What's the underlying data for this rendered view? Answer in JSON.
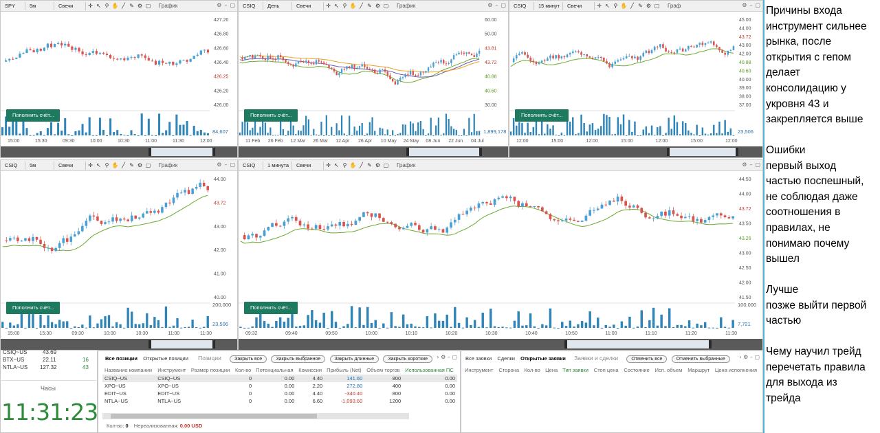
{
  "toolbar_icons": [
    "crosshair-icon",
    "cursor-icon",
    "zoom-icon",
    "hand-icon",
    "draw-line-icon",
    "pencil-icon",
    "settings-icon",
    "square-icon"
  ],
  "charts": {
    "spy": {
      "symbol": "SPY",
      "interval": "5м",
      "type": "Свечи",
      "title": "График",
      "price_axis": [
        "427.20",
        "426.80",
        "426.60",
        "426.40",
        "426.25",
        "426.20",
        "426.00"
      ],
      "time_axis": [
        "15:00",
        "15:30",
        "09:30",
        "10:00",
        "10:30",
        "11:00",
        "11:30",
        "12:00"
      ],
      "deposit_label": "Пополнить счёт...",
      "volume_value": "84,607"
    },
    "csiq_day": {
      "symbol": "CSIQ",
      "interval": "День",
      "type": "Свечи",
      "title": "График",
      "price_axis": [
        "60.00",
        "50.00",
        "43.81",
        "43.72",
        "40.88",
        "40.60",
        "30.00"
      ],
      "time_axis": [
        "11 Feb",
        "26 Feb",
        "12 Mar",
        "26 Mar",
        "12 Apr",
        "26 Apr",
        "10 May",
        "24 May",
        "08 Jun",
        "22 Jun",
        "04 Jul"
      ],
      "deposit_label": "Пополнить счёт...",
      "volume_value": "1,899,178"
    },
    "csiq_15m": {
      "symbol": "CSIQ",
      "interval": "15 минут",
      "type": "Свечи",
      "title": "Граф",
      "price_axis": [
        "45.00",
        "44.00",
        "43.72",
        "43.00",
        "42.00",
        "40.88",
        "40.60",
        "40.00",
        "39.00",
        "38.00",
        "37.00"
      ],
      "time_axis": [
        "12:00",
        "15:00",
        "12:00",
        "15:00",
        "12:00",
        "15:00",
        "12:00"
      ],
      "deposit_label": "Пополнить счёт...",
      "volume_value": "23,506"
    },
    "csiq_5m": {
      "symbol": "CSIQ",
      "interval": "5м",
      "type": "Свечи",
      "title": "График",
      "price_axis": [
        "44.00",
        "43.72",
        "43.00",
        "42.00",
        "41.00",
        "40.00"
      ],
      "time_axis": [
        "15:00",
        "15:30",
        "09:30",
        "10:00",
        "10:30",
        "11:00",
        "11:30"
      ],
      "deposit_label": "Пополнить счёт...",
      "volume_max": "200,000",
      "volume_value": "23,506"
    },
    "csiq_1m": {
      "symbol": "CSIQ",
      "interval": "1 минута",
      "type": "Свечи",
      "title": "График",
      "price_axis": [
        "44.50",
        "44.00",
        "43.72",
        "43.50",
        "43.26",
        "43.00",
        "42.50",
        "42.00",
        "41.50"
      ],
      "time_axis": [
        "09:32",
        "09:40",
        "09:50",
        "10:00",
        "10:10",
        "10:20",
        "10:30",
        "10:40",
        "10:50",
        "11:00",
        "11:10",
        "11:20",
        "11:30"
      ],
      "deposit_label": "Пополнить счёт...",
      "volume_max": "100,000",
      "volume_value": "7,721"
    }
  },
  "watchlist": [
    {
      "symbol": "CSIQ~US",
      "price": "43.69"
    },
    {
      "symbol": "BTX~US",
      "price": "22.11",
      "extra": "16"
    },
    {
      "symbol": "NTLA~US",
      "price": "127.32",
      "extra": "43"
    }
  ],
  "clock": {
    "title": "Часы",
    "time": "11:31:23"
  },
  "positions": {
    "tabs": [
      "Все позиции",
      "Открытые позиции"
    ],
    "section_title": "Позиции",
    "buttons": [
      "Закрыть все",
      "Закрыть выбранное",
      "Закрыть длинные",
      "Закрыть короткие"
    ],
    "columns": [
      "Название компании",
      "Инструмент",
      "Размер позиции",
      "Кол-во",
      "Потенциальная",
      "Комиссии",
      "Прибыль (Net)",
      "Объем торгов",
      "Использованная ПС"
    ],
    "rows": [
      [
        "CSIQ~US",
        "CSIQ~US",
        "",
        "0",
        "0.00",
        "4.40",
        "141.60",
        "800",
        "0.00"
      ],
      [
        "XPO~US",
        "XPO~US",
        "",
        "0",
        "0.00",
        "2.20",
        "272.80",
        "400",
        "0.00"
      ],
      [
        "EDIT~US",
        "EDIT~US",
        "",
        "0",
        "0.00",
        "4.40",
        "-340.40",
        "800",
        "0.00"
      ],
      [
        "NTLA~US",
        "NTLA~US",
        "",
        "0",
        "0.00",
        "6.60",
        "-1,093.60",
        "1200",
        "0.00"
      ]
    ],
    "footer_count_label": "Кол-во:",
    "footer_count": "0",
    "footer_unrealized_label": "Нереализованная:",
    "footer_unrealized": "0.00 USD"
  },
  "orders": {
    "tabs": [
      "Все заявки",
      "Сделки",
      "Открытые заявки"
    ],
    "section_title": "Заявки и сделки",
    "buttons": [
      "Отменить все",
      "Отменить выбранные"
    ],
    "columns": [
      "Инструмент",
      "Сторона",
      "Кол-во",
      "Цена",
      "Тип заявки",
      "Стоп цена",
      "Состояние",
      "Исп. объем",
      "Маршрут",
      "Цена исполнения"
    ]
  },
  "notes": [
    {
      "lines": [
        "Причины входа",
        "инструмент сильнее",
        "рынка, после",
        "открытия с гепом",
        "делает",
        "консолидацию у",
        "укровня 43 и",
        "закрепляется выше"
      ]
    },
    {
      "lines": [
        "Ошибки",
        "первый выход",
        "частью поспешный,",
        "не соблюдая даже",
        "соотношения в",
        "правилах, не",
        "понимаю почему",
        "вышел"
      ]
    },
    {
      "lines": [
        "Лучше",
        "позже выйти первой",
        "частью"
      ]
    },
    {
      "lines": [
        "Чему научил трейд",
        "перечетать правила",
        "для выхода из",
        "трейда"
      ]
    }
  ],
  "colors": {
    "bull": "#4a9fd4",
    "bear": "#d9534f",
    "sma_green": "#6aaa2c",
    "sma_purple": "#6a5aa8",
    "sma_orange": "#f0a020",
    "deposit": "#1d7a5f"
  }
}
